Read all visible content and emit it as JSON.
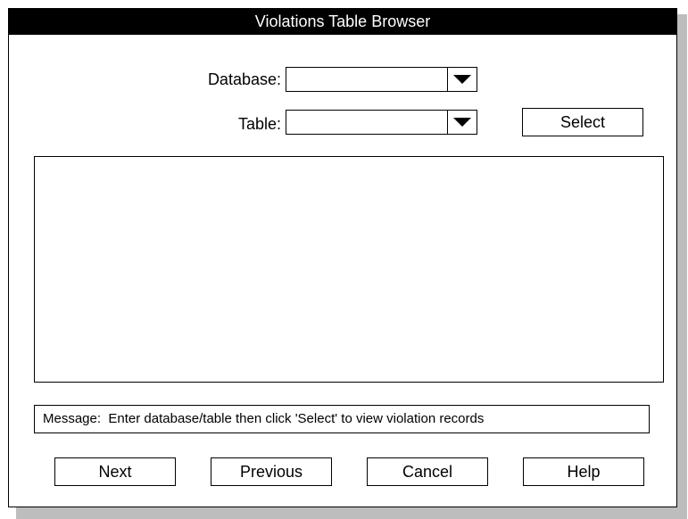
{
  "window": {
    "title": "Violations Table Browser"
  },
  "form": {
    "database_label": "Database:",
    "database_value": "",
    "table_label": "Table:",
    "table_value": "",
    "select_label": "Select"
  },
  "results": {
    "rows": []
  },
  "message": {
    "label": "Message:",
    "text": "Enter database/table then click 'Select' to view violation records"
  },
  "buttons": {
    "next": "Next",
    "previous": "Previous",
    "cancel": "Cancel",
    "help": "Help"
  },
  "icons": {
    "dropdown": "triangle-down-icon"
  }
}
